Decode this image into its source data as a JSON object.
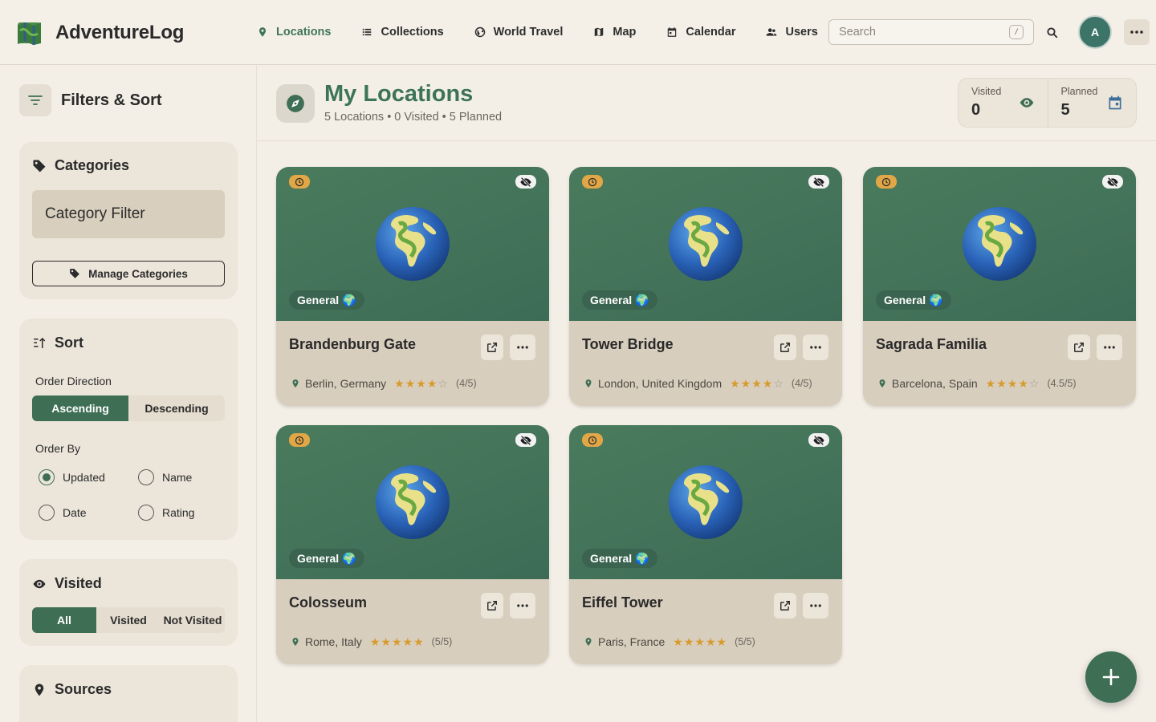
{
  "app": {
    "name": "AdventureLog"
  },
  "nav": {
    "items": [
      {
        "label": "Locations",
        "icon": "pin-icon",
        "active": true
      },
      {
        "label": "Collections",
        "icon": "list-icon"
      },
      {
        "label": "World Travel",
        "icon": "globe-icon"
      },
      {
        "label": "Map",
        "icon": "map-icon"
      },
      {
        "label": "Calendar",
        "icon": "calendar-icon"
      },
      {
        "label": "Users",
        "icon": "users-icon"
      }
    ],
    "search_placeholder": "Search",
    "search_shortcut": "/",
    "avatar_initial": "A"
  },
  "sidebar": {
    "title": "Filters & Sort",
    "categories": {
      "title": "Categories",
      "filter_label": "Category Filter",
      "manage_label": "Manage Categories"
    },
    "sort": {
      "title": "Sort",
      "order_direction_label": "Order Direction",
      "directions": [
        "Ascending",
        "Descending"
      ],
      "order_by_label": "Order By",
      "order_by_options": [
        "Updated",
        "Name",
        "Date",
        "Rating"
      ],
      "selected_order_by": "Updated"
    },
    "visited": {
      "title": "Visited",
      "options": [
        "All",
        "Visited",
        "Not Visited"
      ],
      "selected": "All"
    },
    "sources": {
      "title": "Sources"
    }
  },
  "main": {
    "title": "My Locations",
    "subtitle": "5 Locations • 0 Visited • 5 Planned",
    "stats": {
      "visited_label": "Visited",
      "visited_value": "0",
      "planned_label": "Planned",
      "planned_value": "5"
    }
  },
  "locations": [
    {
      "name": "Brandenburg Gate",
      "category": "General",
      "place": "Berlin, Germany",
      "rating": 4,
      "rating_text": "(4/5)"
    },
    {
      "name": "Tower Bridge",
      "category": "General",
      "place": "London, United Kingdom",
      "rating": 4,
      "rating_text": "(4/5)"
    },
    {
      "name": "Sagrada Familia",
      "category": "General",
      "place": "Barcelona, Spain",
      "rating": 4.5,
      "rating_text": "(4.5/5)"
    },
    {
      "name": "Colosseum",
      "category": "General",
      "place": "Rome, Italy",
      "rating": 5,
      "rating_text": "(5/5)"
    },
    {
      "name": "Eiffel Tower",
      "category": "General",
      "place": "Paris, France",
      "rating": 5,
      "rating_text": "(5/5)"
    }
  ],
  "colors": {
    "accent": "#3e6e54",
    "planned_badge": "#e1a646",
    "star": "#d79b2d"
  }
}
